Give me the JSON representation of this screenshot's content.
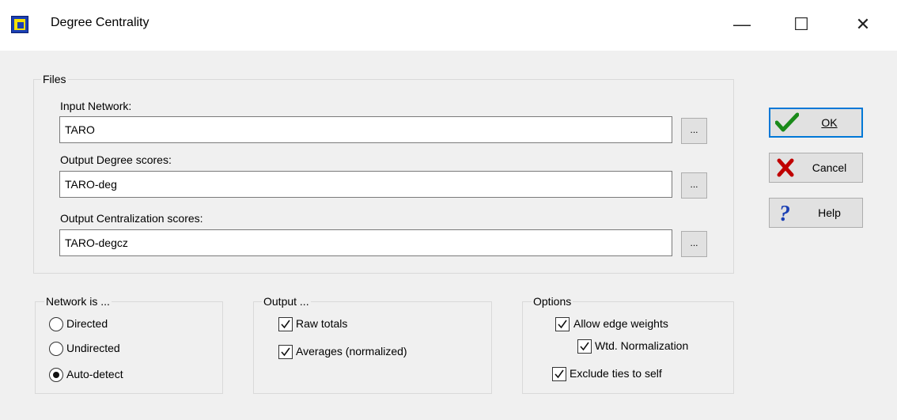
{
  "window": {
    "title": "Degree Centrality",
    "minimize": "—",
    "maximize": "☐",
    "close": "✕"
  },
  "files": {
    "legend": "Files",
    "input_label": "Input Network:",
    "input_value": "TARO",
    "output_degree_label": "Output Degree scores:",
    "output_degree_value": "TARO-deg",
    "output_central_label": "Output Centralization scores:",
    "output_central_value": "TARO-degcz",
    "browse_label": "..."
  },
  "buttons": {
    "ok": {
      "label": "OK",
      "icon": "checkmark-icon",
      "color": "#1a8a1a"
    },
    "cancel": {
      "label": "Cancel",
      "icon": "x-icon",
      "color": "#c00000"
    },
    "help": {
      "label": "Help",
      "icon": "question-icon",
      "color": "#1a3fb4"
    }
  },
  "network": {
    "legend": "Network is ...",
    "options": [
      "Directed",
      "Undirected",
      "Auto-detect"
    ],
    "selected": "Auto-detect"
  },
  "output": {
    "legend": "Output ...",
    "raw_totals": {
      "label": "Raw totals",
      "checked": true
    },
    "averages": {
      "label": "Averages (normalized)",
      "checked": true
    }
  },
  "options": {
    "legend": "Options",
    "allow_edge_weights": {
      "label": "Allow edge weights",
      "checked": true
    },
    "wtd_normalization": {
      "label": "Wtd. Normalization",
      "checked": true
    },
    "exclude_ties": {
      "label": "Exclude ties to self",
      "checked": true
    }
  }
}
